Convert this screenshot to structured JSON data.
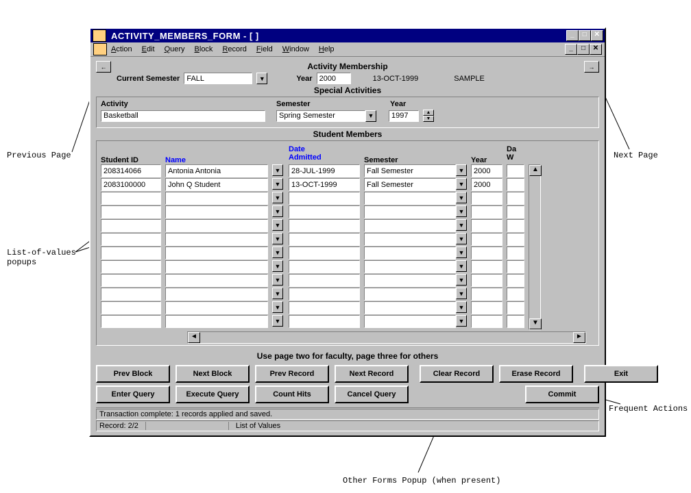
{
  "window": {
    "title": "ACTIVITY_MEMBERS_FORM - [ ]"
  },
  "menus": {
    "action": "Action",
    "edit": "Edit",
    "query": "Query",
    "block": "Block",
    "record": "Record",
    "field": "Field",
    "window": "Window",
    "help": "Help"
  },
  "header": {
    "title": "Activity Membership",
    "current_semester_label": "Current Semester",
    "current_semester_value": "FALL",
    "year_label": "Year",
    "year_value": "2000",
    "date_text": "13-OCT-1999",
    "sample_text": "SAMPLE"
  },
  "special": {
    "title": "Special Activities",
    "activity_label": "Activity",
    "activity_value": "Basketball",
    "semester_label": "Semester",
    "semester_value": "Spring Semester",
    "year_label": "Year",
    "year_value": "1997"
  },
  "members": {
    "title": "Student Members",
    "cols": {
      "student_id": "Student ID",
      "name": "Name",
      "date_admitted_l1": "Date",
      "date_admitted_l2": "Admitted",
      "semester": "Semester",
      "year": "Year",
      "date_w_l1": "Da",
      "date_w_l2": "W"
    },
    "rows": [
      {
        "student_id": "208314066",
        "name": "Antonia  Antonia",
        "date_admitted": "28-JUL-1999",
        "semester": "Fall Semester",
        "year": "2000"
      },
      {
        "student_id": "2083100000",
        "name": "John Q Student",
        "date_admitted": "13-OCT-1999",
        "semester": "Fall Semester",
        "year": "2000"
      },
      {
        "student_id": "",
        "name": "",
        "date_admitted": "",
        "semester": "",
        "year": ""
      },
      {
        "student_id": "",
        "name": "",
        "date_admitted": "",
        "semester": "",
        "year": ""
      },
      {
        "student_id": "",
        "name": "",
        "date_admitted": "",
        "semester": "",
        "year": ""
      },
      {
        "student_id": "",
        "name": "",
        "date_admitted": "",
        "semester": "",
        "year": ""
      },
      {
        "student_id": "",
        "name": "",
        "date_admitted": "",
        "semester": "",
        "year": ""
      },
      {
        "student_id": "",
        "name": "",
        "date_admitted": "",
        "semester": "",
        "year": ""
      },
      {
        "student_id": "",
        "name": "",
        "date_admitted": "",
        "semester": "",
        "year": ""
      },
      {
        "student_id": "",
        "name": "",
        "date_admitted": "",
        "semester": "",
        "year": ""
      },
      {
        "student_id": "",
        "name": "",
        "date_admitted": "",
        "semester": "",
        "year": ""
      },
      {
        "student_id": "",
        "name": "",
        "date_admitted": "",
        "semester": "",
        "year": ""
      }
    ]
  },
  "hint": "Use page two for faculty, page three for others",
  "buttons": {
    "prev_block": "Prev Block",
    "next_block": "Next Block",
    "prev_record": "Prev Record",
    "next_record": "Next Record",
    "clear_record": "Clear Record",
    "erase_record": "Erase Record",
    "exit": "Exit",
    "enter_query": "Enter Query",
    "execute_query": "Execute Query",
    "count_hits": "Count Hits",
    "cancel_query": "Cancel Query",
    "commit": "Commit"
  },
  "status": {
    "msg": "Transaction complete: 1 records applied and saved.",
    "record": "Record: 2/2",
    "lov": "List of Values"
  },
  "callouts": {
    "prev_page": "Previous Page",
    "next_page": "Next Page",
    "lov_popups_l1": "List-of-values",
    "lov_popups_l2": "popups",
    "freq_actions": "Frequent Actions",
    "other_popup": "Other Forms Popup (when present)"
  },
  "glyphs": {
    "left": "←",
    "right": "→",
    "down": "▼",
    "up": "▲",
    "larrow": "◄",
    "rarrow": "►",
    "underscore": "_",
    "square": "□",
    "x": "✕",
    "dbldown": "⯆"
  }
}
